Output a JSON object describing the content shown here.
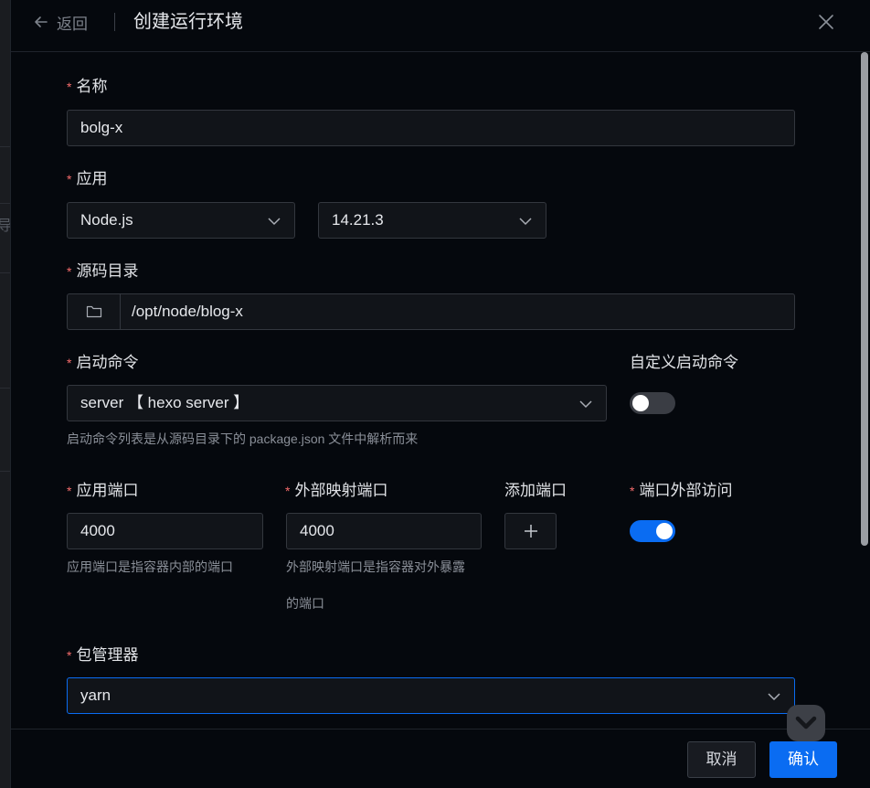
{
  "header": {
    "back_label": "返回",
    "title": "创建运行环境"
  },
  "backdrop": {
    "partial_glyph": "导"
  },
  "form": {
    "name": {
      "label": "名称",
      "value": "bolg-x"
    },
    "app": {
      "label": "应用",
      "app_value": "Node.js",
      "version_value": "14.21.3"
    },
    "source_dir": {
      "label": "源码目录",
      "value": "/opt/node/blog-x"
    },
    "start_cmd": {
      "label": "启动命令",
      "value": "server 【 hexo server 】",
      "hint": "启动命令列表是从源码目录下的 package.json 文件中解析而来"
    },
    "custom_cmd": {
      "label": "自定义启动命令",
      "enabled": false
    },
    "app_port": {
      "label": "应用端口",
      "value": "4000",
      "hint": "应用端口是指容器内部的端口"
    },
    "ext_port": {
      "label": "外部映射端口",
      "value": "4000",
      "hint_line1": "外部映射端口是指容器对外暴露",
      "hint_line2": "的端口"
    },
    "add_port": {
      "label": "添加端口"
    },
    "external_access": {
      "label": "端口外部访问",
      "enabled": true
    },
    "pkg_manager": {
      "label": "包管理器",
      "value": "yarn"
    }
  },
  "footer": {
    "cancel_label": "取消",
    "confirm_label": "确认"
  },
  "colors": {
    "accent": "#0a6cf2",
    "required": "#f56c6c",
    "switch_off": "#3a3d44"
  }
}
